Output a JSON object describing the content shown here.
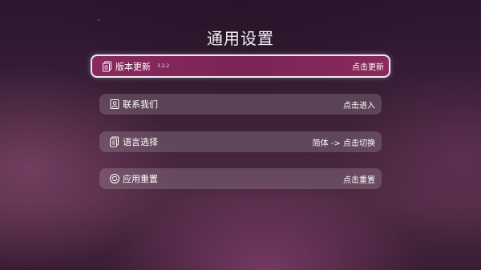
{
  "header": {
    "title": "通用设置"
  },
  "settings": {
    "items": [
      {
        "label": "版本更新",
        "version": "3.2.2",
        "action": "点击更新",
        "icon": "document-icon",
        "focused": true
      },
      {
        "label": "联系我们",
        "action": "点击进入",
        "icon": "contact-card-icon"
      },
      {
        "label": "语言选择",
        "action": "简体 -> 点击切换",
        "icon": "language-icon"
      },
      {
        "label": "应用重置",
        "action": "点击重置",
        "icon": "reset-icon"
      }
    ]
  },
  "colors": {
    "focused_row": "#7c2456",
    "focus_border": "#f2e7ee",
    "row_background": "rgba(255,255,255,0.16)"
  }
}
